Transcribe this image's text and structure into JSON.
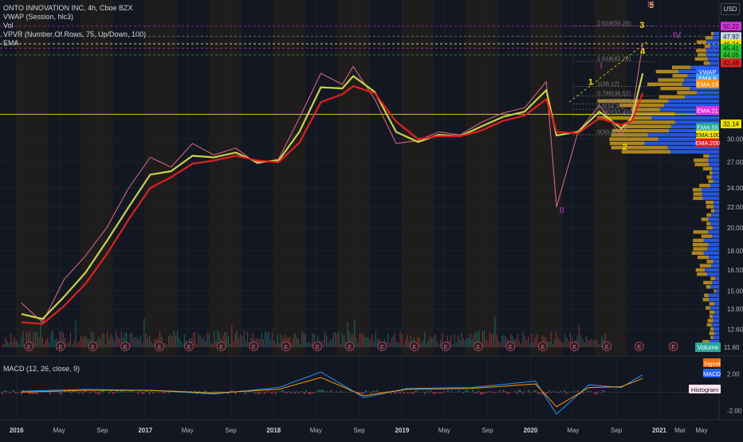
{
  "legend": {
    "title": "ONTO INNOVATION INC, 4h, Cboe BZX",
    "indicators": [
      "VWAP (Session, hlc3)",
      "Vol",
      "VPVR (Number Of Rows, 75, Up/Down, 100)",
      "EMA"
    ],
    "macd": "MACD (12, 26, close, 9)"
  },
  "currency": "USD",
  "colors": {
    "background": "#131722",
    "ema_short": "#c9d24a",
    "ema_long": "#e0201f",
    "price_line": "#d4c02a",
    "fib_magenta": "#e030e0",
    "wave_yellow": "#f2e300",
    "wave_magenta": "#c040c0",
    "volume_profile_up": "#2962ff",
    "volume_profile_down": "#c99a1f"
  },
  "chart_data": [
    {
      "type": "line",
      "title": "ONTO INNOVATION INC, 4h, Cboe BZX",
      "x": [
        "2016-01",
        "2016-03",
        "2016-05",
        "2016-07",
        "2016-09",
        "2016-11",
        "2017-01",
        "2017-03",
        "2017-05",
        "2017-07",
        "2017-09",
        "2017-11",
        "2018-01",
        "2018-03",
        "2018-05",
        "2018-07",
        "2018-08",
        "2018-10",
        "2018-12",
        "2019-02",
        "2019-04",
        "2019-06",
        "2019-08",
        "2019-10",
        "2019-12",
        "2020-02",
        "2020-03",
        "2020-05",
        "2020-07",
        "2020-09",
        "2020-10",
        "2020-11"
      ],
      "series": [
        {
          "name": "close",
          "values": [
            14.2,
            13.0,
            15.8,
            17.6,
            20.1,
            24.0,
            27.6,
            26.4,
            29.4,
            27.9,
            28.8,
            26.8,
            27.4,
            33.0,
            40.5,
            38.5,
            41.8,
            36.0,
            29.4,
            29.8,
            31.0,
            30.6,
            32.4,
            33.8,
            34.6,
            39.0,
            22.0,
            31.0,
            35.0,
            30.5,
            33.5,
            46.5
          ]
        },
        {
          "name": "EMA:100",
          "values": [
            13.5,
            13.2,
            14.6,
            16.3,
            18.9,
            22.0,
            25.5,
            25.9,
            27.8,
            27.6,
            28.2,
            27.0,
            27.2,
            31.0,
            38.0,
            37.8,
            40.0,
            37.2,
            31.0,
            29.6,
            30.6,
            30.4,
            31.8,
            33.2,
            34.0,
            37.5,
            30.5,
            31.0,
            34.0,
            31.5,
            33.0,
            40.5
          ]
        },
        {
          "name": "EMA:200",
          "values": [
            13.0,
            12.9,
            14.0,
            15.5,
            17.8,
            20.8,
            24.0,
            25.2,
            26.8,
            27.2,
            27.8,
            27.2,
            27.0,
            29.5,
            35.5,
            36.8,
            38.2,
            37.0,
            32.5,
            30.0,
            30.4,
            30.4,
            31.2,
            32.6,
            33.4,
            36.0,
            31.0,
            30.8,
            33.0,
            32.0,
            32.6,
            37.0
          ]
        }
      ],
      "ylim": [
        11.6,
        50.2
      ],
      "y_ticks": [
        12.6,
        13.8,
        15.0,
        16.5,
        18.0,
        20.0,
        22.0,
        24.0,
        27.0,
        30.0
      ],
      "x_tick_labels": [
        {
          "label": "2016",
          "date": "2016-01-01",
          "year": true
        },
        {
          "label": "May",
          "date": "2016-05-01"
        },
        {
          "label": "Sep",
          "date": "2016-09-01"
        },
        {
          "label": "2017",
          "date": "2017-01-01",
          "year": true
        },
        {
          "label": "May",
          "date": "2017-05-01"
        },
        {
          "label": "Sep",
          "date": "2017-09-01"
        },
        {
          "label": "2018",
          "date": "2018-01-01",
          "year": true
        },
        {
          "label": "May",
          "date": "2018-05-01"
        },
        {
          "label": "Sep",
          "date": "2018-09-01"
        },
        {
          "label": "2019",
          "date": "2019-01-01",
          "year": true
        },
        {
          "label": "May",
          "date": "2019-05-01"
        },
        {
          "label": "Sep",
          "date": "2019-09-01"
        },
        {
          "label": "2020",
          "date": "2020-01-01",
          "year": true
        },
        {
          "label": "May",
          "date": "2020-05-01"
        },
        {
          "label": "Sep",
          "date": "2020-09-01"
        },
        {
          "label": "2021",
          "date": "2021-01-01",
          "year": true
        },
        {
          "label": "Mar",
          "date": "2021-03-01"
        },
        {
          "label": "May",
          "date": "2021-05-01"
        }
      ],
      "horizontal_line": 33.6,
      "fib_levels": [
        {
          "label": "2.618(50.26)",
          "value": 50.26
        },
        {
          "label": "1.618(42.76)",
          "value": 42.76
        },
        {
          "label": "1(38.12)",
          "value": 38.12
        },
        {
          "label": "0.786(36.52)",
          "value": 36.52
        },
        {
          "label": "0.618(35.26)",
          "value": 35.26
        },
        {
          "label": "0.5(34.37)",
          "value": 34.37
        },
        {
          "label": "0.382(33.49)",
          "value": 33.49
        },
        {
          "label": "0(30.6)",
          "value": 30.6
        }
      ],
      "wave_labels_yellow": [
        {
          "label": "1",
          "date": "2020-06-20",
          "value": 38.4
        },
        {
          "label": "2",
          "date": "2020-09-25",
          "value": 28.6
        },
        {
          "label": "3",
          "date": "2020-11-13",
          "value": 49.8
        },
        {
          "label": "4",
          "date": "2020-11-15",
          "value": 44.2
        },
        {
          "label": "5",
          "date": "2020-12-10",
          "value": 55.5
        }
      ],
      "wave_labels_magenta": [
        {
          "label": "I",
          "date": "2020-07-20",
          "value": 41.4
        },
        {
          "label": "II",
          "date": "2020-03-30",
          "value": 21.4
        },
        {
          "label": "III",
          "date": "2020-12-08",
          "value": 57.0
        },
        {
          "label": "IV",
          "date": "2021-02-20",
          "value": 47.6
        }
      ],
      "price_tags": [
        {
          "label": "50.22",
          "value": 50.22,
          "color": "#e030e0"
        },
        {
          "label": "47.92",
          "value": 47.92,
          "color": "#c8d6e5"
        },
        {
          "label": "46.47",
          "value": 46.47,
          "color": "#c8d6e5"
        },
        {
          "label": "46.24",
          "value": 46.24,
          "color": "#f2e300"
        },
        {
          "label": "45.41",
          "value": 45.41,
          "color": "#26c629"
        },
        {
          "label": "44.05",
          "value": 44.05,
          "color": "#26c629"
        },
        {
          "label": "42.48",
          "value": 42.48,
          "color": "#e0201f"
        },
        {
          "label": "32.14",
          "value": 32.14,
          "color": "#f2e300"
        }
      ],
      "ema_tags": [
        {
          "label": "VWAP",
          "value": 40.8,
          "color": "#2962ff"
        },
        {
          "label": "EMA:8",
          "value": 39.6,
          "color": "#42a5f5"
        },
        {
          "label": "EMA:13",
          "value": 38.6,
          "color": "#f7931a"
        },
        {
          "label": "EMA:21",
          "value": 34.2,
          "color": "#e030e0"
        },
        {
          "label": "EMA:55",
          "value": 31.7,
          "color": "#26a69a"
        },
        {
          "label": "EMA:100",
          "value": 30.6,
          "color": "#f2e300"
        },
        {
          "label": "EMA:200",
          "value": 29.5,
          "color": "#e0201f"
        }
      ],
      "earnings_marker": "E",
      "earnings_dates": [
        "2016-02-05",
        "2016-05-05",
        "2016-08-05",
        "2016-11-05",
        "2017-02-10",
        "2017-05-05",
        "2017-08-05",
        "2017-11-05",
        "2018-02-05",
        "2018-05-05",
        "2018-08-05",
        "2018-11-05",
        "2019-02-05",
        "2019-05-05",
        "2019-08-05",
        "2019-11-05",
        "2020-02-05",
        "2020-05-05",
        "2020-08-05",
        "2020-11-05",
        "2021-02-10"
      ],
      "volume_label": "Volume"
    },
    {
      "type": "line",
      "title": "MACD (12, 26, close, 9)",
      "x": [
        "2016-01",
        "2016-07",
        "2017-01",
        "2017-07",
        "2018-01",
        "2018-05",
        "2018-09",
        "2019-01",
        "2019-07",
        "2020-01",
        "2020-03",
        "2020-06",
        "2020-09",
        "2020-11"
      ],
      "series": [
        {
          "name": "MACD",
          "values": [
            0.1,
            0.3,
            0.2,
            -0.2,
            0.5,
            2.2,
            -0.6,
            0.4,
            0.5,
            1.2,
            -2.4,
            0.8,
            0.5,
            1.9
          ]
        },
        {
          "name": "Signal",
          "values": [
            0.0,
            0.2,
            0.2,
            -0.1,
            0.3,
            1.6,
            -0.4,
            0.3,
            0.4,
            0.9,
            -1.6,
            0.5,
            0.6,
            1.5
          ]
        }
      ],
      "ylim": [
        -2.5,
        3.0
      ],
      "y_ticks": [
        2.0,
        -2.0
      ],
      "legend": [
        "Signal",
        "MACD",
        "Histogram"
      ]
    }
  ]
}
